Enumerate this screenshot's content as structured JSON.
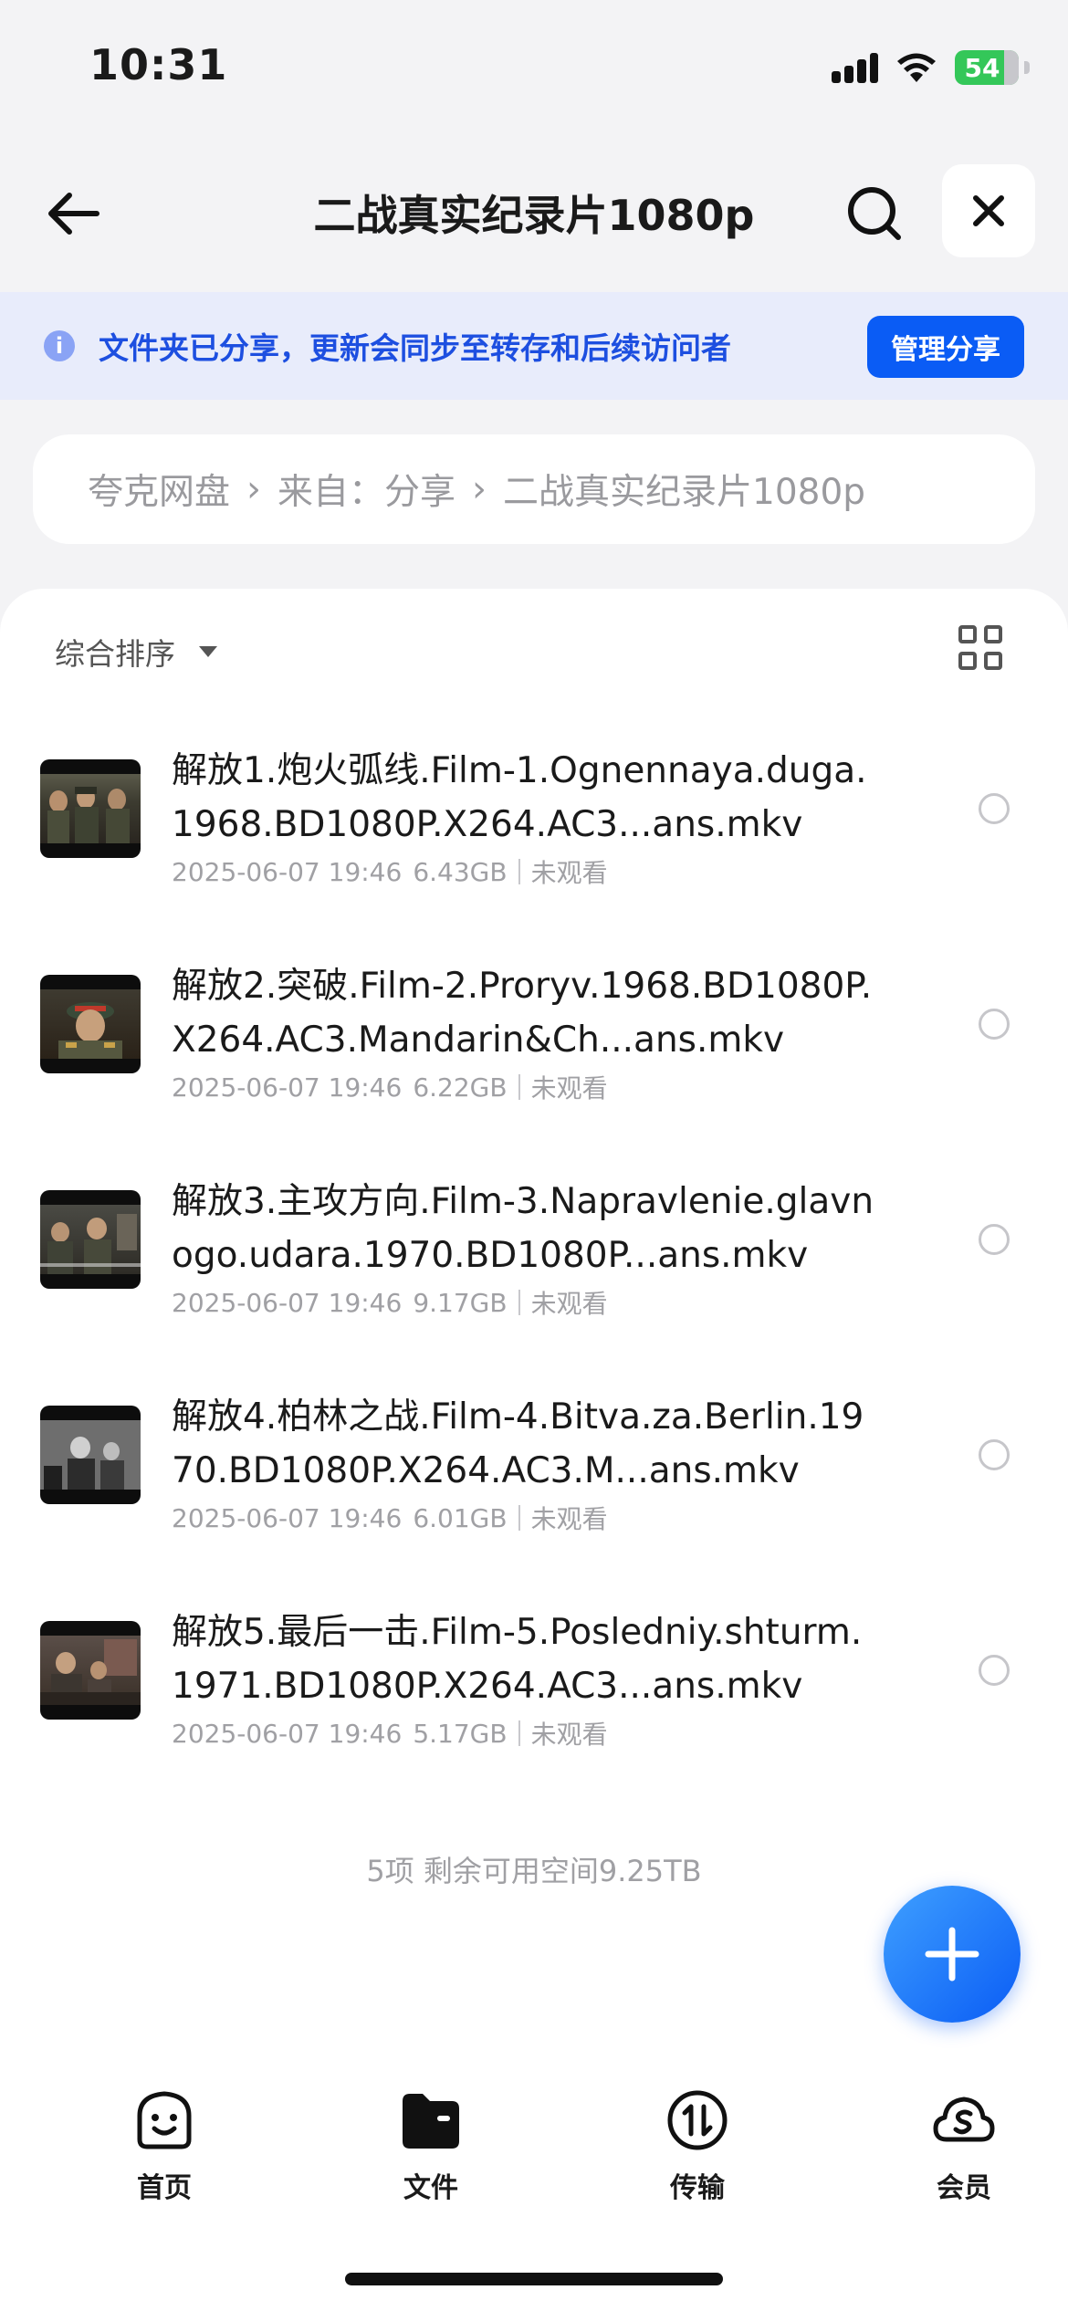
{
  "status_bar": {
    "time": "10:31",
    "battery": "54",
    "battery_color": "#34c759"
  },
  "header": {
    "title": "二战真实纪录片1080p",
    "back_icon": "arrow-left-icon",
    "search_icon": "search-icon",
    "close_icon": "close-icon"
  },
  "share_banner": {
    "info_glyph": "i",
    "text": "文件夹已分享，更新会同步至转存和后续访问者",
    "button_label": "管理分享",
    "accent": "#0a5cf5"
  },
  "breadcrumb": {
    "items": [
      "夸克网盘",
      "来自：分享",
      "二战真实纪录片1080p"
    ],
    "separator": "›"
  },
  "toolbar": {
    "sort_label": "综合排序",
    "view_icon": "grid-view-icon"
  },
  "files": [
    {
      "name": "解放1.炮火弧线.Film-1.Ognennaya.duga.1968.BD1080P.X264.AC3...ans.mkv",
      "date": "2025-06-07 19:46",
      "size": "6.43GB",
      "status": "未观看"
    },
    {
      "name": "解放2.突破.Film-2.Proryv.1968.BD1080P.X264.AC3.Mandarin&Ch...ans.mkv",
      "date": "2025-06-07 19:46",
      "size": "6.22GB",
      "status": "未观看"
    },
    {
      "name": "解放3.主攻方向.Film-3.Napravlenie.glavnogo.udara.1970.BD1080P...ans.mkv",
      "date": "2025-06-07 19:46",
      "size": "9.17GB",
      "status": "未观看"
    },
    {
      "name": "解放4.柏林之战.Film-4.Bitva.za.Berlin.1970.BD1080P.X264.AC3.M...ans.mkv",
      "date": "2025-06-07 19:46",
      "size": "6.01GB",
      "status": "未观看"
    },
    {
      "name": "解放5.最后一击.Film-5.Posledniy.shturm.1971.BD1080P.X264.AC3...ans.mkv",
      "date": "2025-06-07 19:46",
      "size": "5.17GB",
      "status": "未观看"
    }
  ],
  "summary": "5项 剩余可用空间9.25TB",
  "fab_icon": "plus-icon",
  "tabs": [
    {
      "label": "首页",
      "icon": "home-smile-icon"
    },
    {
      "label": "文件",
      "icon": "folder-icon"
    },
    {
      "label": "传输",
      "icon": "transfer-icon"
    },
    {
      "label": "会员",
      "icon": "vip-cloud-icon"
    }
  ]
}
